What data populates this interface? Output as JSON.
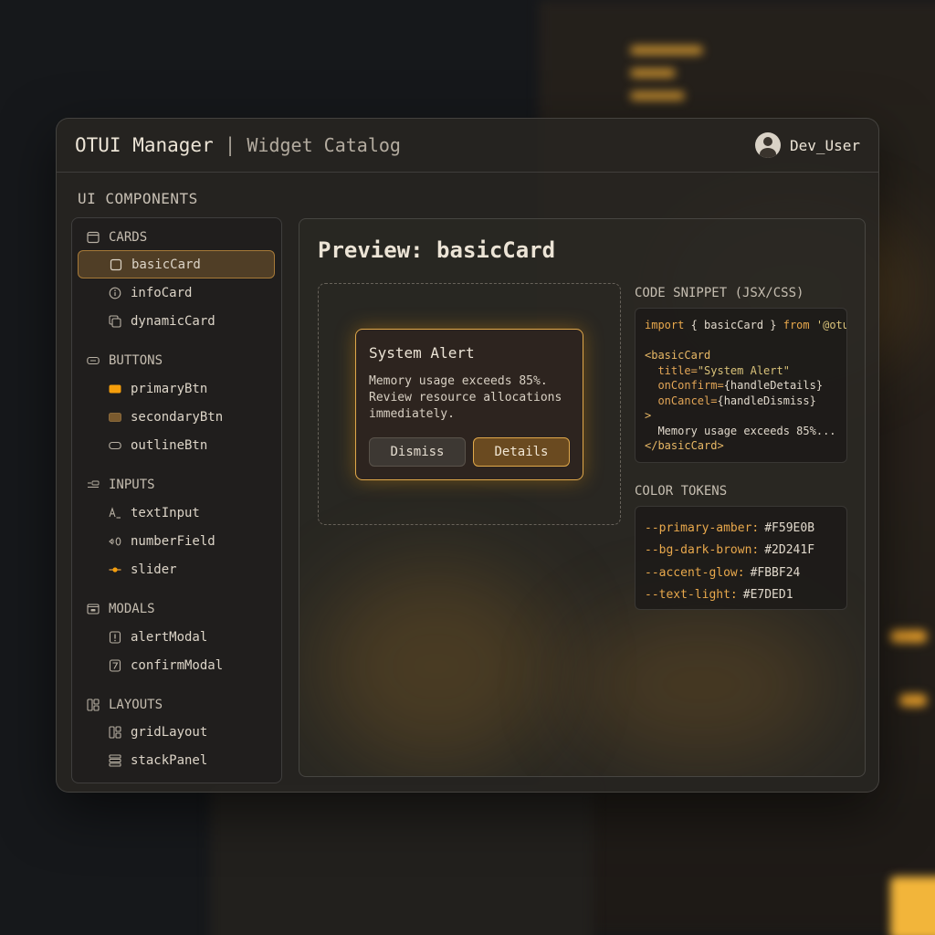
{
  "header": {
    "app_title": "OTUI Manager",
    "separator": "|",
    "page_subtitle": "Widget Catalog",
    "username": "Dev_User"
  },
  "sidebar": {
    "heading": "UI COMPONENTS",
    "groups": [
      {
        "label": "CARDS",
        "icon": "card-icon",
        "items": [
          {
            "label": "basicCard",
            "icon": "square-icon",
            "selected": true
          },
          {
            "label": "infoCard",
            "icon": "info-icon"
          },
          {
            "label": "dynamicCard",
            "icon": "stacked-cards-icon"
          }
        ]
      },
      {
        "label": "BUTTONS",
        "icon": "button-icon",
        "items": [
          {
            "label": "primaryBtn",
            "icon": "primary-swatch-icon",
            "color": "#F59E0B"
          },
          {
            "label": "secondaryBtn",
            "icon": "secondary-swatch-icon",
            "color": "#7A5A2E"
          },
          {
            "label": "outlineBtn",
            "icon": "outline-swatch-icon"
          }
        ]
      },
      {
        "label": "INPUTS",
        "icon": "input-icon",
        "items": [
          {
            "label": "textInput",
            "icon": "text-input-icon"
          },
          {
            "label": "numberField",
            "icon": "number-field-icon"
          },
          {
            "label": "slider",
            "icon": "slider-icon"
          }
        ]
      },
      {
        "label": "MODALS",
        "icon": "modal-icon",
        "items": [
          {
            "label": "alertModal",
            "icon": "alert-icon"
          },
          {
            "label": "confirmModal",
            "icon": "confirm-icon"
          }
        ]
      },
      {
        "label": "LAYOUTS",
        "icon": "layout-icon",
        "items": [
          {
            "label": "gridLayout",
            "icon": "grid-icon"
          },
          {
            "label": "stackPanel",
            "icon": "stack-icon"
          }
        ]
      }
    ]
  },
  "preview": {
    "title": "Preview: basicCard",
    "card": {
      "title": "System Alert",
      "body": "Memory usage exceeds 85%. Review resource allocations immediately.",
      "dismiss_label": "Dismiss",
      "details_label": "Details"
    },
    "code_label": "CODE SNIPPET (JSX/CSS)",
    "code": {
      "import_kw": "import",
      "import_body": " { basicCard } ",
      "from_kw": "from",
      "import_src": " '@otui",
      "open_tag": "<basicCard",
      "attr_title": "title=",
      "attr_title_val": "\"System Alert\"",
      "attr_confirm": "onConfirm=",
      "attr_confirm_val": "{handleDetails}",
      "attr_cancel": "onCancel=",
      "attr_cancel_val": "{handleDismiss}",
      "close_bracket": ">",
      "content": "  Memory usage exceeds 85%...",
      "close_tag": "</basicCard>"
    },
    "tokens_label": "COLOR TOKENS",
    "tokens": [
      {
        "name": "--primary-amber:",
        "value": "#F59E0B"
      },
      {
        "name": "--bg-dark-brown:",
        "value": "#2D241F"
      },
      {
        "name": "--accent-glow:",
        "value": "#FBBF24"
      },
      {
        "name": "--text-light:",
        "value": "#E7DED1"
      }
    ]
  },
  "colors": {
    "accent": "#F59E0B",
    "accent_glow": "#FBBF24",
    "bg_dark_brown": "#2D241F",
    "text_light": "#E7DED1"
  }
}
